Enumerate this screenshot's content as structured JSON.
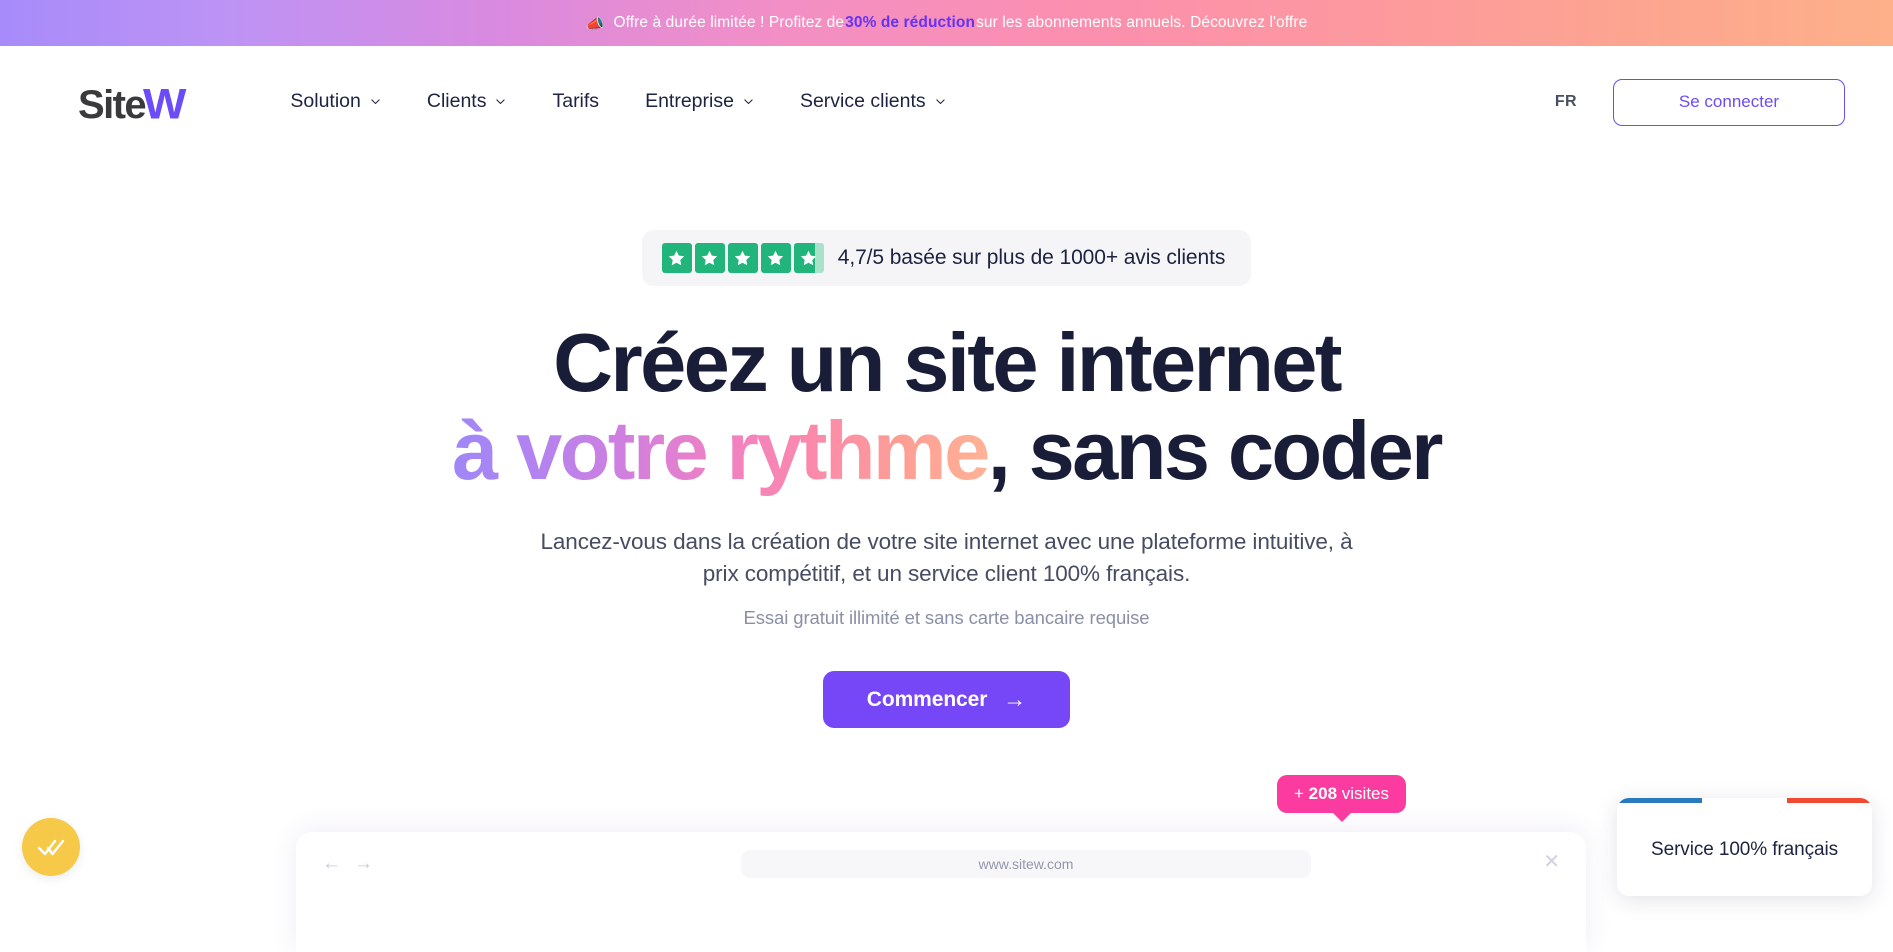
{
  "promo": {
    "icon": "megaphone-icon",
    "text_before": "Offre à durée limitée ! Profitez de",
    "highlight": "30% de réduction",
    "text_after": "sur les abonnements annuels. Découvrez l'offre"
  },
  "header": {
    "logo": {
      "primary": "Site",
      "accent": "W"
    },
    "nav": [
      {
        "label": "Solution",
        "has_dropdown": true
      },
      {
        "label": "Clients",
        "has_dropdown": true
      },
      {
        "label": "Tarifs",
        "has_dropdown": false
      },
      {
        "label": "Entreprise",
        "has_dropdown": true
      },
      {
        "label": "Service clients",
        "has_dropdown": true
      }
    ],
    "language": "FR",
    "login_label": "Se connecter"
  },
  "hero": {
    "rating": {
      "stars_total": 5,
      "stars_filled": 4,
      "partial_fill_percent": 70,
      "text": "4,7/5 basée sur plus de 1000+ avis clients"
    },
    "title_line1": "Créez un site internet",
    "title_line2_gradient": "à votre rythme",
    "title_line2_rest": ", sans coder",
    "subtitle": "Lancez-vous dans la création de votre site internet avec une plateforme intuitive, à prix compétitif, et un service client 100% français.",
    "note": "Essai gratuit illimité et sans carte bancaire requise",
    "cta_label": "Commencer",
    "cta_arrow": "→"
  },
  "floating": {
    "visits_prefix": "+",
    "visits_count": "208",
    "visits_suffix": "visites",
    "french_service_label": "Service 100% français"
  },
  "browser_mock": {
    "back_arrow": "←",
    "forward_arrow": "→",
    "url": "www.sitew.com",
    "close": "✕"
  },
  "colors": {
    "accent_purple": "#7547f7",
    "heading_navy": "#191d38",
    "pink_badge": "#fb3ba0",
    "star_green": "#21b57c",
    "chat_yellow": "#f7c948",
    "flag_blue": "#2a7ac0",
    "flag_red": "#ef4b33"
  }
}
